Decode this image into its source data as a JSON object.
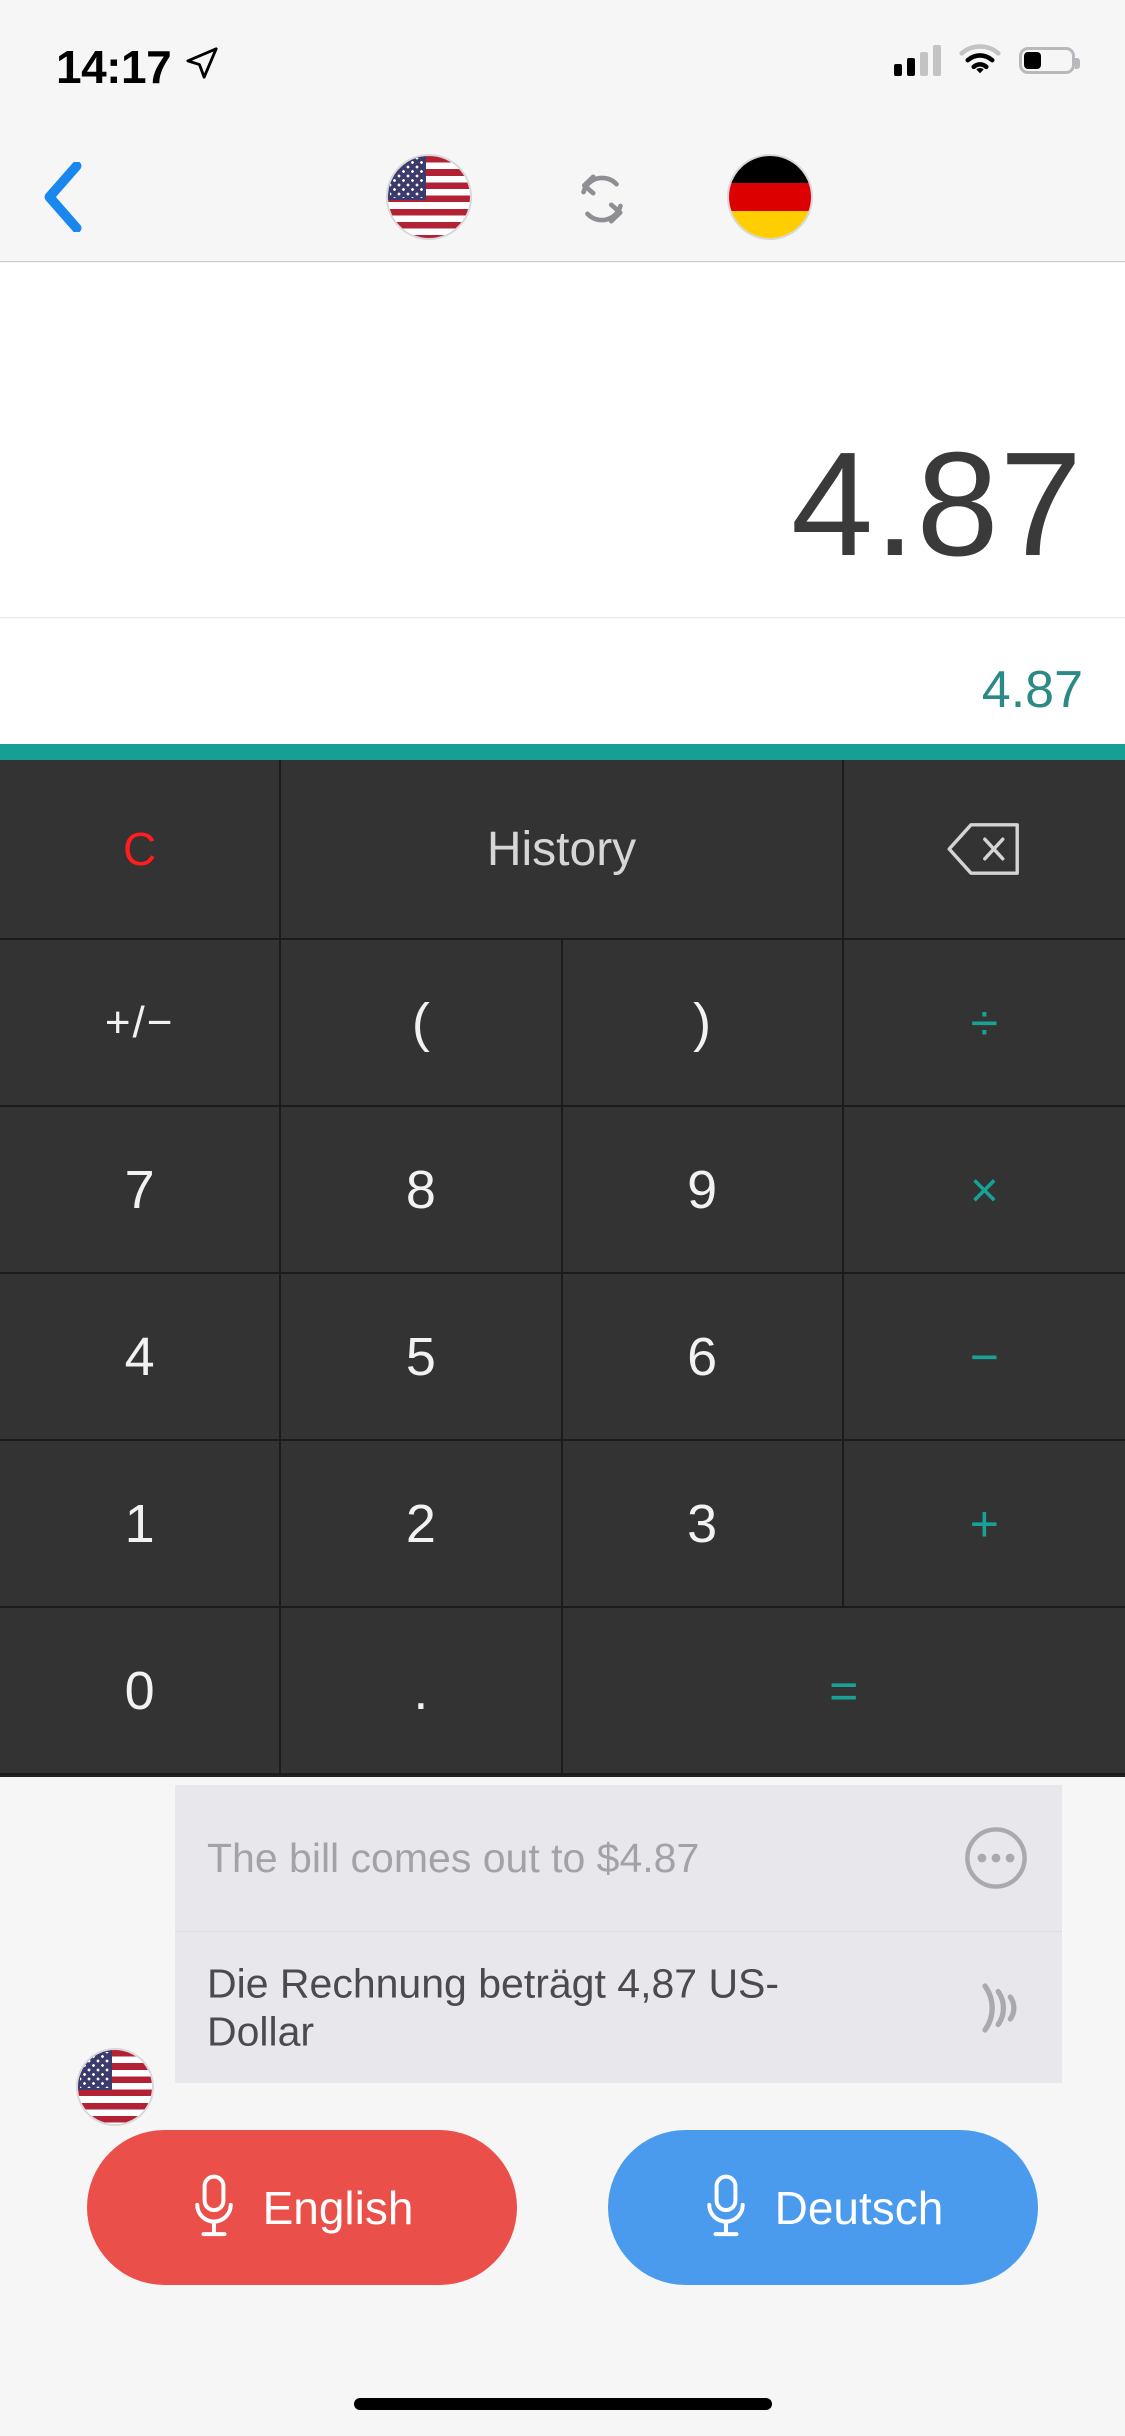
{
  "status_bar": {
    "time": "14:17",
    "location_icon": "location-arrow-icon",
    "signal_icon": "cellular-signal-icon",
    "signal_bars_filled": 2,
    "signal_bars_total": 4,
    "wifi_icon": "wifi-icon",
    "battery_icon": "battery-icon",
    "battery_percent": 38
  },
  "nav_bar": {
    "back_icon": "chevron-left-icon",
    "source_flag": "flag-us-icon",
    "swap_icon": "swap-languages-icon",
    "target_flag": "flag-de-icon"
  },
  "display": {
    "primary_value": "4.87",
    "converted_value": "4.87",
    "accent_color": "#16a093",
    "converted_color": "#2b8a86"
  },
  "keypad": {
    "rows": [
      [
        {
          "label": "C",
          "name": "key-clear",
          "style": "clear",
          "width": "k1"
        },
        {
          "label": "History",
          "name": "key-history",
          "style": "hist",
          "width": "hist"
        },
        {
          "label": "",
          "name": "key-backspace",
          "style": "backspace",
          "width": "k1"
        }
      ],
      [
        {
          "label": "+/−",
          "name": "key-plus-minus",
          "style": "pm",
          "width": "k1"
        },
        {
          "label": "(",
          "name": "key-paren-open",
          "style": "num",
          "width": "k2"
        },
        {
          "label": ")",
          "name": "key-paren-close",
          "style": "num",
          "width": "k3"
        },
        {
          "label": "÷",
          "name": "key-divide",
          "style": "op",
          "width": "k4"
        }
      ],
      [
        {
          "label": "7",
          "name": "key-7",
          "style": "num",
          "width": "k1"
        },
        {
          "label": "8",
          "name": "key-8",
          "style": "num",
          "width": "k2"
        },
        {
          "label": "9",
          "name": "key-9",
          "style": "num",
          "width": "k3"
        },
        {
          "label": "×",
          "name": "key-multiply",
          "style": "op",
          "width": "k4"
        }
      ],
      [
        {
          "label": "4",
          "name": "key-4",
          "style": "num",
          "width": "k1"
        },
        {
          "label": "5",
          "name": "key-5",
          "style": "num",
          "width": "k2"
        },
        {
          "label": "6",
          "name": "key-6",
          "style": "num",
          "width": "k3"
        },
        {
          "label": "−",
          "name": "key-subtract",
          "style": "op",
          "width": "k4"
        }
      ],
      [
        {
          "label": "1",
          "name": "key-1",
          "style": "num",
          "width": "k1"
        },
        {
          "label": "2",
          "name": "key-2",
          "style": "num",
          "width": "k2"
        },
        {
          "label": "3",
          "name": "key-3",
          "style": "num",
          "width": "k3"
        },
        {
          "label": "+",
          "name": "key-add",
          "style": "op",
          "width": "k4"
        }
      ],
      [
        {
          "label": "0",
          "name": "key-0",
          "style": "num",
          "width": "k1"
        },
        {
          "label": ".",
          "name": "key-decimal",
          "style": "dot",
          "width": "k2"
        },
        {
          "label": "=",
          "name": "key-equals",
          "style": "op",
          "width": "wide2"
        }
      ]
    ],
    "backspace_icon": "backspace-icon"
  },
  "translation": {
    "source_text": "The bill comes out to $4.87",
    "source_action_icon": "more-options-icon",
    "target_text": "Die Rechnung beträgt 4,87 US-Dollar",
    "target_action_icon": "speaker-volume-icon",
    "corner_flag": "flag-us-icon"
  },
  "mic_buttons": {
    "source": {
      "label": "English",
      "icon": "microphone-icon",
      "color": "#eb4f4a"
    },
    "target": {
      "label": "Deutsch",
      "icon": "microphone-icon",
      "color": "#4a9bed"
    }
  },
  "home_indicator": "home-indicator"
}
